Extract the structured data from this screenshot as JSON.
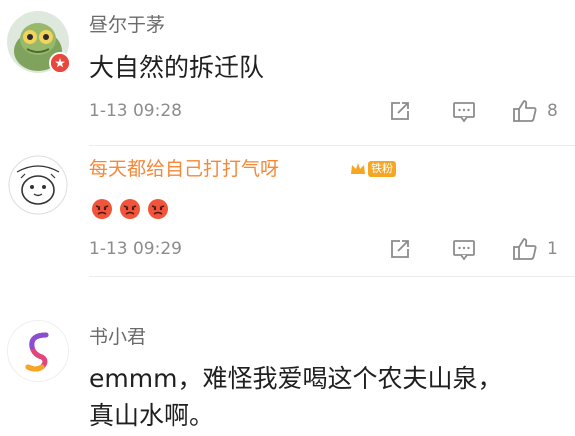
{
  "colors": {
    "accent_orange": "#f5893a",
    "username_gray": "#6b6b6b",
    "meta_gray": "#8c8c8c",
    "vip_red": "#e8473d"
  },
  "comments": [
    {
      "username": "昼尔于茅",
      "text": "大自然的拆迁队",
      "time": "1-13 09:28",
      "like_count": "8"
    },
    {
      "username": "每天都给自己打打气呀",
      "badge_label": "铁粉",
      "text": "",
      "time": "1-13 09:29",
      "like_count": "1"
    },
    {
      "username": "书小君",
      "text_line1": "emmm，难怪我爱喝这个农夫山泉，",
      "text_line2": "真山水啊。"
    }
  ],
  "icons": {
    "repost": "repost-icon",
    "comment": "comment-icon",
    "like": "thumbs-up-icon",
    "vip": "vip-badge-icon",
    "crown": "crown-icon",
    "emoji": "angry-face-emoji"
  }
}
